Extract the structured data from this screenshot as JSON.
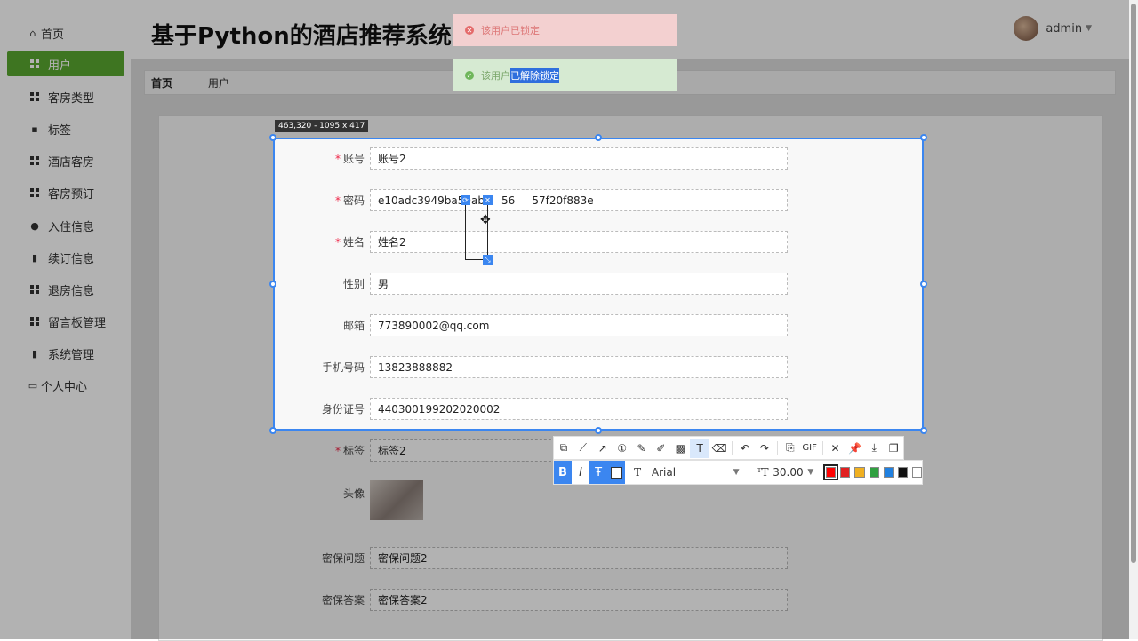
{
  "sidebar": {
    "items": [
      {
        "label": "首页",
        "icon": "home-icon"
      },
      {
        "label": "用户",
        "icon": "grid-icon"
      },
      {
        "label": "客房类型",
        "icon": "grid-icon"
      },
      {
        "label": "标签",
        "icon": "comment-icon"
      },
      {
        "label": "酒店客房",
        "icon": "grid-icon"
      },
      {
        "label": "客房预订",
        "icon": "grid-icon"
      },
      {
        "label": "入住信息",
        "icon": "user-icon"
      },
      {
        "label": "续订信息",
        "icon": "bar-chart-icon"
      },
      {
        "label": "退房信息",
        "icon": "grid-icon"
      },
      {
        "label": "留言板管理",
        "icon": "grid-icon"
      },
      {
        "label": "系统管理",
        "icon": "clipboard-icon"
      },
      {
        "label": "个人中心",
        "icon": "panel-icon"
      }
    ]
  },
  "header": {
    "title": "基于Python的酒店推荐系统的设",
    "username": "admin"
  },
  "breadcrumb": {
    "home": "首页",
    "sep": "——",
    "current": "用户"
  },
  "toasts": {
    "error": "该用户已锁定",
    "success_prefix": "该用户",
    "success_highlight": "已解除锁定"
  },
  "form": {
    "fields": [
      {
        "label": "账号",
        "required": true,
        "value": "账号2"
      },
      {
        "label": "密码",
        "required": true,
        "value": "e10adc3949ba59ab     56     57f20f883e"
      },
      {
        "label": "姓名",
        "required": true,
        "value": "姓名2"
      },
      {
        "label": "性别",
        "required": false,
        "value": "男"
      },
      {
        "label": "邮箱",
        "required": false,
        "value": "773890002@qq.com"
      },
      {
        "label": "手机号码",
        "required": false,
        "value": "13823888882"
      },
      {
        "label": "身份证号",
        "required": false,
        "value": "440300199202020002"
      },
      {
        "label": "标签",
        "required": true,
        "value": "标签2"
      },
      {
        "label": "头像",
        "required": false,
        "value": ""
      },
      {
        "label": "密保问题",
        "required": false,
        "value": "密保问题2"
      },
      {
        "label": "密保答案",
        "required": false,
        "value": "密保答案2"
      }
    ],
    "required_mark": "*"
  },
  "capture": {
    "dimension_label": "463,320 - 1095 x 417",
    "selection_color": "#3b86f0"
  },
  "toolbar": {
    "tools": [
      "rect-ellipse-icon",
      "polyline-icon",
      "arrow-icon",
      "number-icon",
      "pen-icon",
      "highlighter-icon",
      "mosaic-icon",
      "text-icon",
      "eraser-icon",
      "undo-icon",
      "redo-icon",
      "save-icon",
      "gif-icon",
      "close-icon",
      "pin-icon",
      "download-icon",
      "copy-icon"
    ],
    "gif_label": "GIF",
    "bold_label": "B",
    "italic_label": "I",
    "font_name": "Arial",
    "font_size": "30.00",
    "colors": [
      "#ff0000",
      "#e02020",
      "#f0b020",
      "#30a040",
      "#2080e0",
      "#111111",
      "#ffffff"
    ]
  }
}
